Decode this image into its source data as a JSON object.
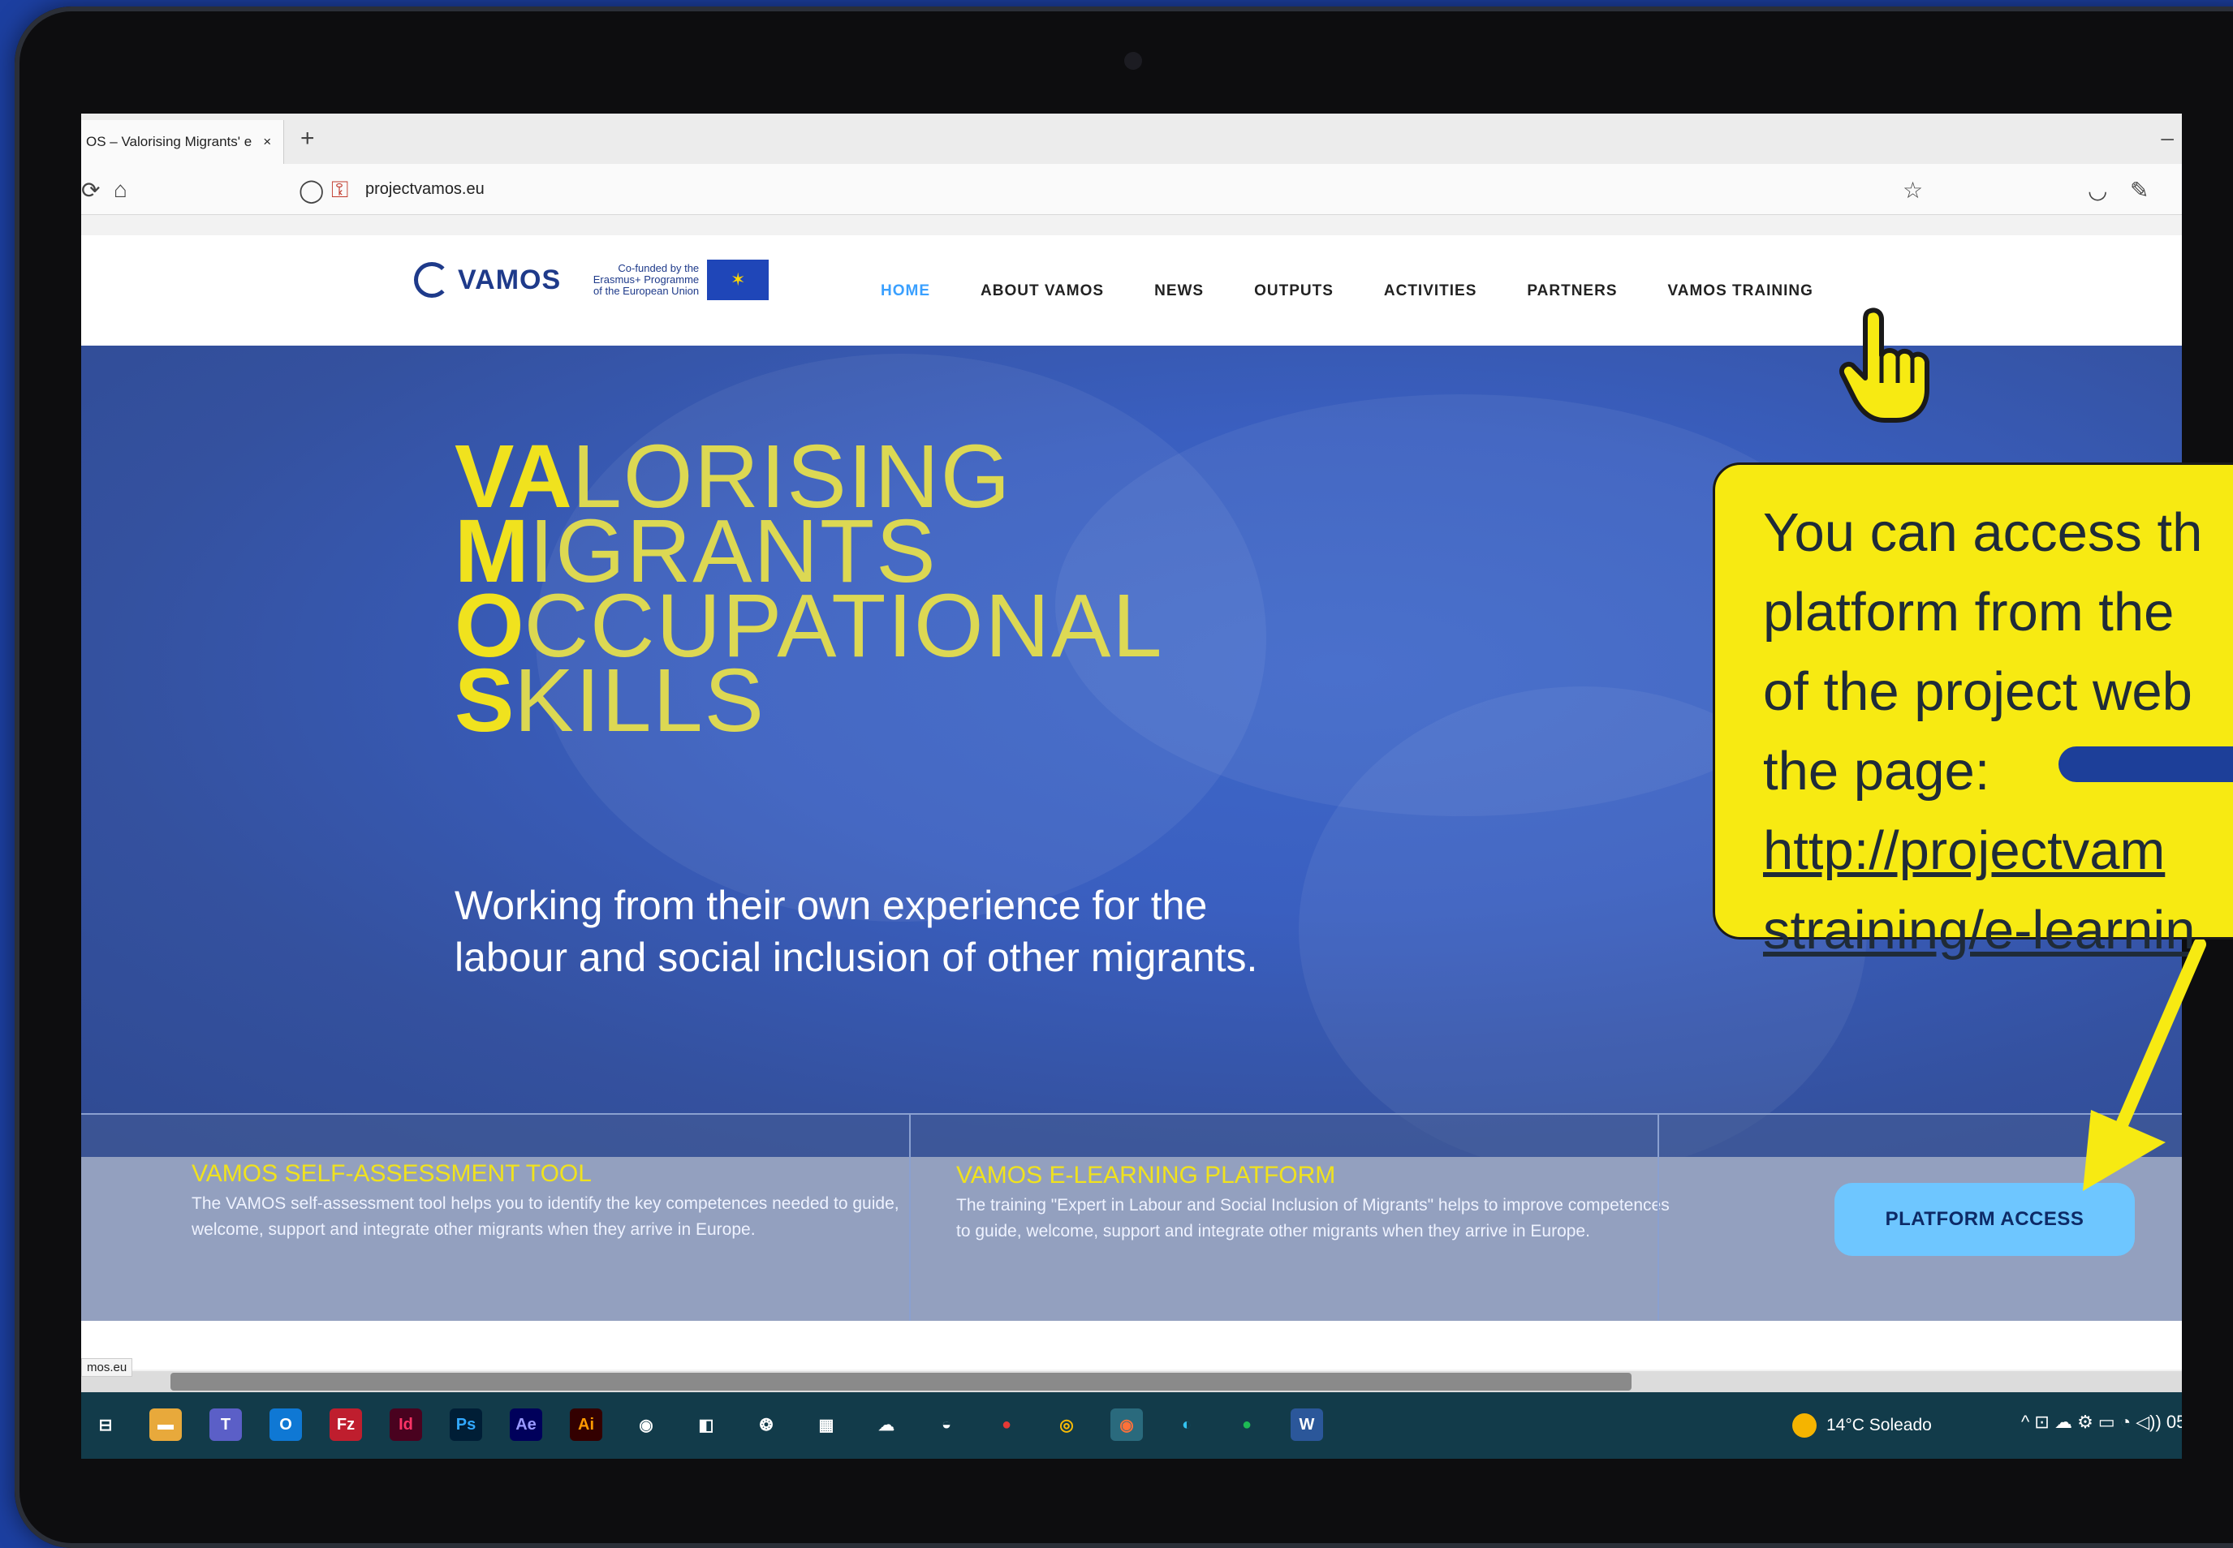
{
  "browser": {
    "tab_title": "OS – Valorising Migrants' e",
    "tab_close": "×",
    "new_tab": "+",
    "minimize": "–",
    "url": "projectvamos.eu",
    "status_url": "mos.eu"
  },
  "site": {
    "logo_text": "VAMOS",
    "cofund_text_1": "Co-funded by the",
    "cofund_text_2": "Erasmus+ Programme",
    "cofund_text_3": "of the European Union",
    "nav": [
      {
        "label": "HOME",
        "active": true
      },
      {
        "label": "ABOUT VAMOS"
      },
      {
        "label": "NEWS"
      },
      {
        "label": "OUTPUTS"
      },
      {
        "label": "ACTIVITIES"
      },
      {
        "label": "PARTNERS"
      },
      {
        "label": "VAMOS TRAINING"
      }
    ],
    "hero": {
      "line1_bold": "VA",
      "line1_rest": "LORISING",
      "line2_bold": "M",
      "line2_rest": "IGRANTS",
      "line3_bold": "O",
      "line3_rest": "CCUPATIONAL",
      "line4_bold": "S",
      "line4_rest": "KILLS",
      "subtitle": "Working from their own experience for the labour and social inclusion of other migrants."
    },
    "cards": [
      {
        "title": "VAMOS SELF-ASSESSMENT TOOL",
        "text": "The VAMOS self-assessment tool helps you to identify the key competences needed to guide, welcome, support and integrate other migrants when they arrive in Europe."
      },
      {
        "title": "VAMOS E-LEARNING PLATFORM",
        "text": "The training \"Expert in Labour and Social Inclusion of Migrants\" helps to improve competences to guide, welcome, support and integrate other migrants when they arrive in Europe."
      }
    ],
    "platform_button": "PLATFORM ACCESS"
  },
  "callout": {
    "line1": "You can access th",
    "line2": "platform from the",
    "line3": "of the project web",
    "line4": "the page:",
    "link1": "http://projectvam",
    "link2": "straining/e-learnin"
  },
  "taskbar": {
    "apps": [
      "Fz",
      "Id",
      "Ps",
      "Ae",
      "Ai",
      "W"
    ],
    "weather": "14°C  Soleado",
    "tray": "^ ⊡ ☁ ⚙ ▭ ◔ ◁)) 05/"
  },
  "colors": {
    "accent_yellow": "#f0e21e",
    "hero_blue": "#3a5fc0",
    "button_blue": "#6ec6ff",
    "callout_yellow": "#f7ea12",
    "taskbar": "#123b4a"
  }
}
